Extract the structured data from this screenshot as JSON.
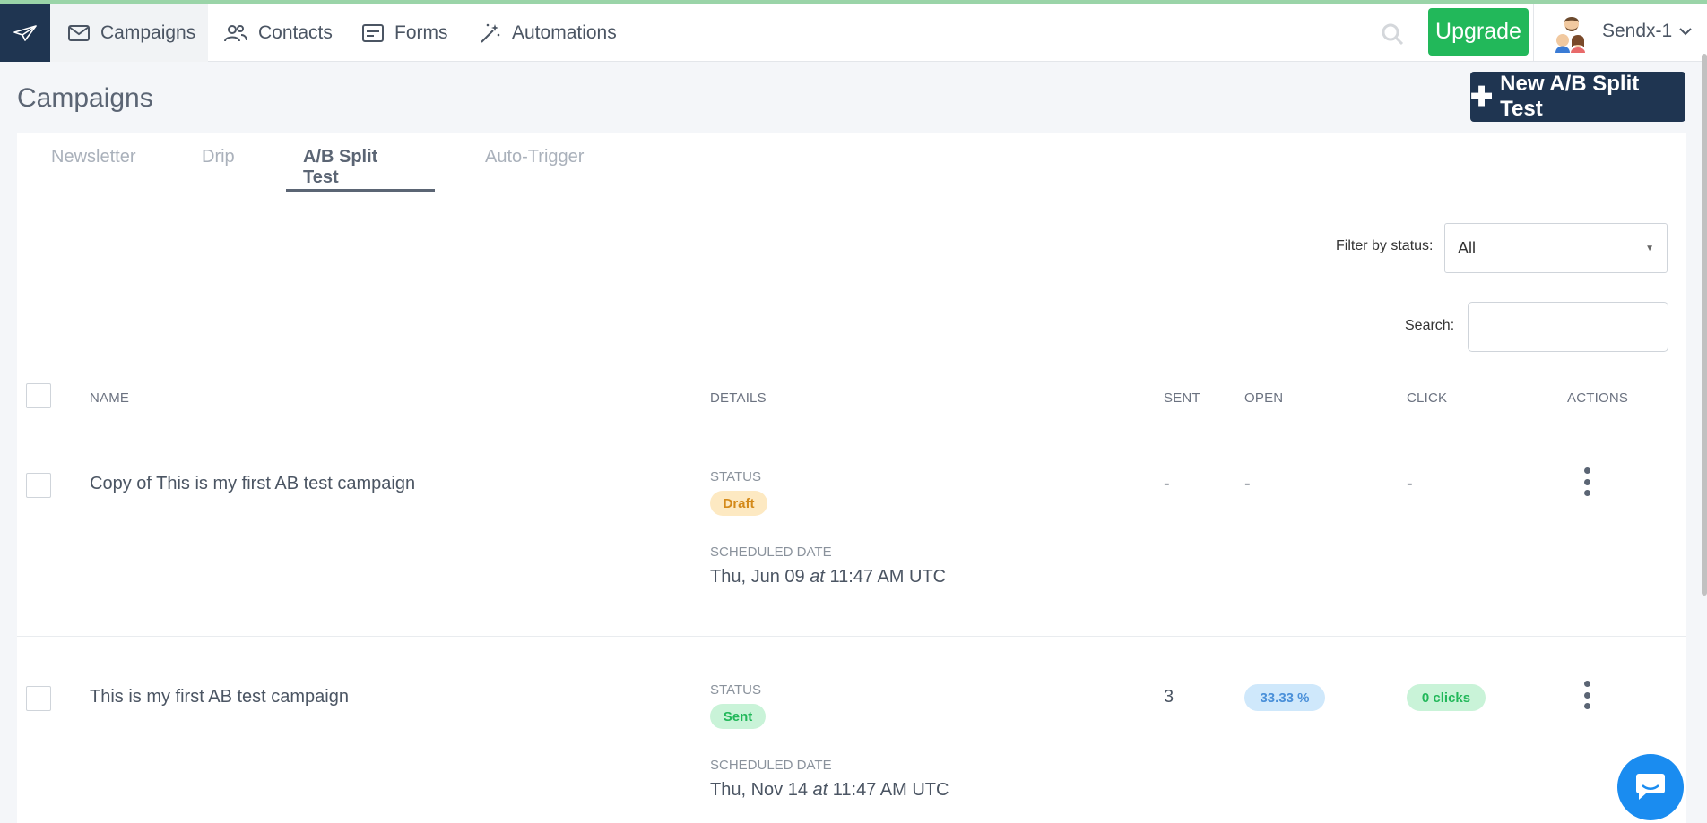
{
  "nav": {
    "items": [
      {
        "label": "Campaigns",
        "icon": "mail-icon"
      },
      {
        "label": "Contacts",
        "icon": "users-icon"
      },
      {
        "label": "Forms",
        "icon": "form-icon"
      },
      {
        "label": "Automations",
        "icon": "magic-wand-icon"
      }
    ],
    "upgrade_label": "Upgrade",
    "account_name": "Sendx-1"
  },
  "page": {
    "title": "Campaigns",
    "new_button_label": "New A/B Split Test"
  },
  "tabs": [
    {
      "label": "Newsletter",
      "active": false
    },
    {
      "label": "Drip",
      "active": false
    },
    {
      "label": "A/B Split Test",
      "active": true
    },
    {
      "label": "Auto-Trigger",
      "active": false
    }
  ],
  "filter": {
    "label": "Filter by status:",
    "value": "All"
  },
  "search": {
    "label": "Search:",
    "value": ""
  },
  "table": {
    "headers": {
      "name": "NAME",
      "details": "DETAILS",
      "sent": "SENT",
      "open": "OPEN",
      "click": "CLICK",
      "actions": "ACTIONS"
    },
    "rows": [
      {
        "name": "Copy of This is my first AB test campaign",
        "status_label": "STATUS",
        "status": "Draft",
        "date_label": "SCHEDULED DATE",
        "date_day": "Thu, Jun 09",
        "date_at": "at",
        "date_time": "11:47 AM UTC",
        "sent": "-",
        "open": "-",
        "click": "-"
      },
      {
        "name": "This is my first AB test campaign",
        "status_label": "STATUS",
        "status": "Sent",
        "date_label": "SCHEDULED DATE",
        "date_day": "Thu, Nov 14",
        "date_at": "at",
        "date_time": "11:47 AM UTC",
        "sent": "3",
        "open": "33.33 %",
        "click": "0 clicks"
      }
    ]
  },
  "colors": {
    "brand_dark": "#1f3551",
    "upgrade_green": "#22b85a",
    "chat_blue": "#1a8cf0"
  }
}
